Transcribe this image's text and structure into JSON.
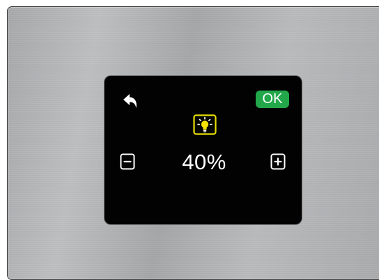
{
  "colors": {
    "panel": "#b1b3b5",
    "screen": "#020202",
    "ok_button": "#22a84a",
    "bulb_frame": "#e8e000",
    "text": "#ffffff"
  },
  "icons": {
    "back": "back-arrow-icon",
    "brightness": "light-bulb-icon",
    "decrease": "minus-icon",
    "increase": "plus-icon"
  },
  "controls": {
    "ok_label": "OK"
  },
  "brightness": {
    "value_text": "40%",
    "level_percent": 40
  }
}
